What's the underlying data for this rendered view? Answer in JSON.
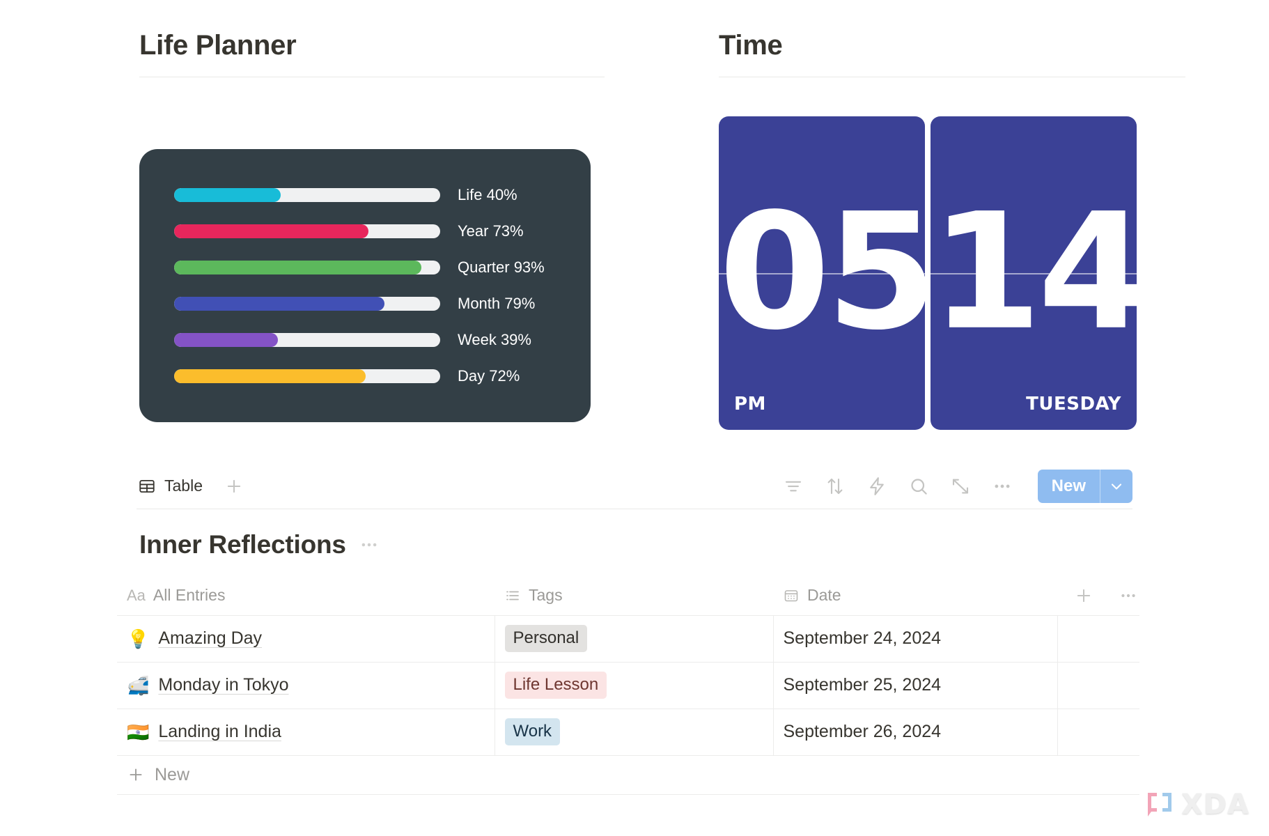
{
  "columns": {
    "left_title": "Life Planner",
    "right_title": "Time"
  },
  "progress_widget": {
    "bars": [
      {
        "label": "Life 40%",
        "name": "Life",
        "percent": 40,
        "color": "#18bcd8"
      },
      {
        "label": "Year 73%",
        "name": "Year",
        "percent": 73,
        "color": "#e8265c"
      },
      {
        "label": "Quarter 93%",
        "name": "Quarter",
        "percent": 93,
        "color": "#5cb85c"
      },
      {
        "label": "Month 79%",
        "name": "Month",
        "percent": 79,
        "color": "#4150b5"
      },
      {
        "label": "Week 39%",
        "name": "Week",
        "percent": 39,
        "color": "#8453c6"
      },
      {
        "label": "Day 72%",
        "name": "Day",
        "percent": 72,
        "color": "#fbbd2c"
      }
    ],
    "card_color": "#333f46",
    "track_color": "#f0f1f2"
  },
  "clock": {
    "hour": "05",
    "minute": "14",
    "meridiem": "PM",
    "weekday": "TUESDAY",
    "card_color": "#3b4196"
  },
  "toolbar": {
    "view_label": "Table",
    "view_icon": "table-icon",
    "add_view_icon": "plus-icon",
    "icons": [
      {
        "name": "filter-icon"
      },
      {
        "name": "sort-icon"
      },
      {
        "name": "automation-icon"
      },
      {
        "name": "search-icon"
      },
      {
        "name": "expand-icon"
      },
      {
        "name": "more-icon"
      }
    ],
    "new_label": "New",
    "new_caret_icon": "chevron-down-icon",
    "new_color": "#8fbcf0"
  },
  "database": {
    "title": "Inner Reflections",
    "title_more_icon": "more-icon",
    "columns": [
      {
        "key": "name",
        "label": "All Entries",
        "icon": "text-icon",
        "icon_glyph": "Aa"
      },
      {
        "key": "tags",
        "label": "Tags",
        "icon": "multiselect-icon"
      },
      {
        "key": "date",
        "label": "Date",
        "icon": "calendar-icon"
      }
    ],
    "header_actions": {
      "add_property_icon": "plus-icon",
      "more_icon": "more-icon"
    },
    "rows": [
      {
        "emoji": "💡",
        "emoji_name": "lightbulb-emoji",
        "name": "Amazing Day",
        "tag": "Personal",
        "tag_style": "tag-personal",
        "date": "September 24, 2024"
      },
      {
        "emoji": "🚅",
        "emoji_name": "bullet-train-emoji",
        "name": "Monday in Tokyo",
        "tag": "Life Lesson",
        "tag_style": "tag-life",
        "date": "September 25, 2024"
      },
      {
        "emoji": "🇮🇳",
        "emoji_name": "india-flag-emoji",
        "name": "Landing in India",
        "tag": "Work",
        "tag_style": "tag-work",
        "date": "September 26, 2024"
      }
    ],
    "new_row_label": "New",
    "new_row_icon": "plus-icon"
  },
  "watermark": {
    "text": "XDA",
    "bracket_left_color": "#f2a0b4",
    "bracket_right_color": "#9cc8ea"
  }
}
